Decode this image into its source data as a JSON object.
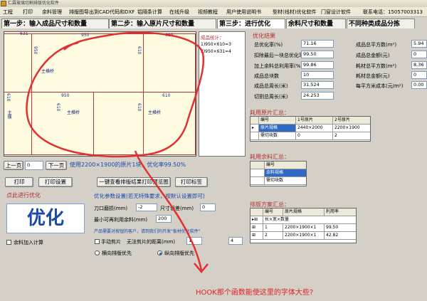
{
  "window": {
    "title": "仁霖玻璃切割排版优化软件"
  },
  "menu": [
    "工程",
    "打印",
    "余料管理",
    "排版图导出到CAD代码和DXF",
    "铝隔条计算",
    "在线升级",
    "视频教程",
    "用户使用说明书",
    "型材(线材)优化软件",
    "门窗设计软件",
    "联系电话：15057003313"
  ],
  "steps": [
    {
      "label": "第一步：输入成品尺寸和数量",
      "active": false
    },
    {
      "label": "第二步：输入原片尺寸和数量",
      "active": false
    },
    {
      "label": "第三步：进行优化",
      "active": true
    },
    {
      "label": "余料尺寸和数量",
      "active": false
    },
    {
      "label": "不同种类成品分拣",
      "active": false
    }
  ],
  "canvas": {
    "top_labels": [
      "631",
      "950",
      "610"
    ],
    "widths": [
      "950",
      "610"
    ],
    "heights": [
      "950",
      "610"
    ],
    "mid_labels": [
      "610",
      "610",
      "610"
    ],
    "room_label": "主横桥",
    "side_labels": [
      "主横",
      "主横桥",
      "主横桥"
    ]
  },
  "stats": {
    "title": "成品统计：",
    "lines": [
      "1)950×610=3",
      "2)950×631=4"
    ]
  },
  "pager": {
    "prev_label": "上一页",
    "page_value": "0",
    "next_label": "下一页",
    "info": "使用2200×1900的原片1块，优化率99.50%"
  },
  "actions": {
    "print": "打印",
    "print_setup": "打印设置",
    "preview_all": "一键查看排版结果打印预览图",
    "print_label": "打印标签"
  },
  "results": {
    "title": "优化结果",
    "fields": [
      {
        "label": "总优化率(%)",
        "value": "71.16"
      },
      {
        "label": "扣除最后一块总优化率(%)",
        "value": "99.50"
      },
      {
        "label": "加上余料总利用率(%)",
        "value": "99.86"
      },
      {
        "label": "成品总块数",
        "value": "10"
      },
      {
        "label": "成品总周长(米)",
        "value": "31.524"
      },
      {
        "label": "切割总周长(米)",
        "value": "24.253"
      }
    ],
    "right_fields": [
      {
        "label": "成品总平方数(m²)",
        "value": "5.94"
      },
      {
        "label": "成品总金额(元)",
        "value": "0"
      },
      {
        "label": "耗材总平方数(m²)",
        "value": "8.36"
      },
      {
        "label": "耗材总金额(元)",
        "value": "0"
      },
      {
        "label": "每平方米成本(元/m²)",
        "value": "0.00"
      }
    ]
  },
  "consumed": {
    "title": "耗用原片汇总：",
    "headers": [
      "编号",
      "1号原片",
      "2号原片"
    ],
    "rows": [
      [
        "原片规格",
        "2440×2000",
        "2200×1900"
      ],
      [
        "需切块数",
        "0",
        "2"
      ]
    ]
  },
  "leftover": {
    "title": "耗用余料汇总：",
    "headers": [
      "编号"
    ],
    "rows": [
      [
        "余料规格"
      ],
      [
        "需切块数"
      ]
    ]
  },
  "schemes": {
    "title": "排版方案汇总：",
    "headers": [
      "编号",
      "原片规格",
      "利用率"
    ],
    "subheader": "长×宽×数量",
    "rows": [
      [
        "1",
        "2200×1900×1",
        "99.50"
      ],
      [
        "2",
        "2200×1900×1",
        "42.82"
      ]
    ]
  },
  "optimize": {
    "hint": "点此进行优化",
    "button": "优化",
    "leftover_join": "余料加入计算"
  },
  "params": {
    "title": "优化参数设置(若无特殊要求，按默认设置即可)",
    "kerf_label": "刀口磨损(mm)",
    "kerf_value": "-2",
    "size_diff_label": "尺寸误差(mm)",
    "size_diff_value": "0",
    "min_leftover_label": "最小可再利用余料(mm)",
    "min_leftover_value": "200",
    "note": "产品需要对按钮的客户，请到我们的开发\"板材优化软件\"",
    "manual_cut": "手动剪片",
    "no_spacing": "无法剪片的距离(mm)",
    "spacing_value_a": "1",
    "spacing_value_b": "4",
    "radio_horizontal": "横向排版优先",
    "radio_vertical": "纵向排版优先"
  },
  "annotation": "HOOK那个函数能使这里的字体大些?"
}
